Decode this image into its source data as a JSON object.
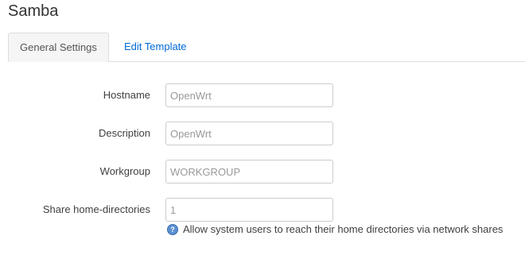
{
  "page": {
    "title": "Samba"
  },
  "tabs": [
    {
      "label": "General Settings",
      "active": true
    },
    {
      "label": "Edit Template",
      "active": false
    }
  ],
  "form": {
    "hostname": {
      "label": "Hostname",
      "placeholder": "OpenWrt",
      "value": ""
    },
    "description": {
      "label": "Description",
      "placeholder": "OpenWrt",
      "value": ""
    },
    "workgroup": {
      "label": "Workgroup",
      "placeholder": "WORKGROUP",
      "value": ""
    },
    "homes": {
      "label": "Share home-directories",
      "placeholder": "1",
      "value": "",
      "help": "Allow system users to reach their home directories via network shares"
    }
  },
  "icons": {
    "help": "help-icon"
  },
  "colors": {
    "link": "#0069d6",
    "tab_active_bg": "#f5f5f5",
    "help_icon": "#5b8fd0"
  }
}
